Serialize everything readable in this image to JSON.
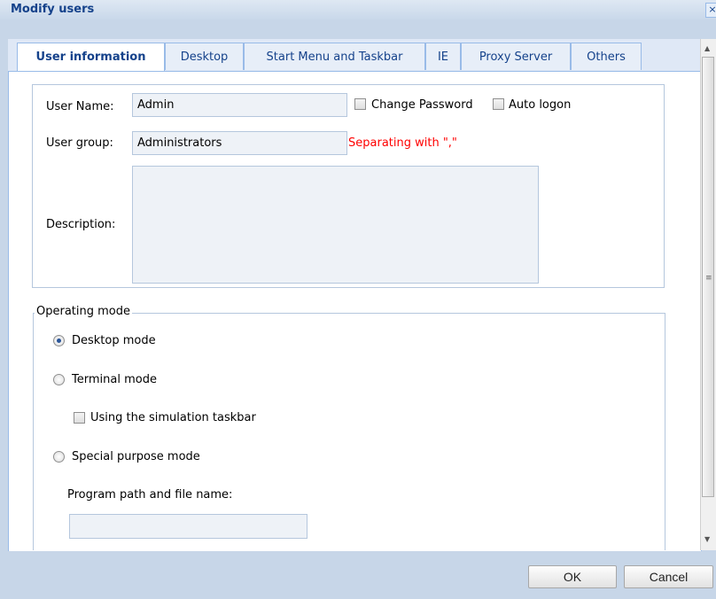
{
  "window": {
    "title": "Modify users",
    "close_glyph": "×"
  },
  "tabs": [
    {
      "label": "User information",
      "active": true
    },
    {
      "label": "Desktop"
    },
    {
      "label": "Start Menu and Taskbar"
    },
    {
      "label": "IE"
    },
    {
      "label": "Proxy Server"
    },
    {
      "label": "Others"
    }
  ],
  "user_info": {
    "username_label": "User Name:",
    "username_value": "Admin",
    "change_password_label": "Change Password",
    "auto_logon_label": "Auto logon",
    "group_label": "User group:",
    "group_value": "Administrators",
    "group_hint": "Separating with \",\"",
    "description_label": "Description:",
    "description_value": ""
  },
  "operating_mode": {
    "legend": "Operating mode",
    "desktop_mode_label": "Desktop mode",
    "terminal_mode_label": "Terminal mode",
    "simulation_taskbar_label": "Using the simulation taskbar",
    "special_purpose_label": "Special purpose mode",
    "program_path_label": "Program path and file name:",
    "program_path_value": "",
    "selected": "Desktop mode"
  },
  "buttons": {
    "ok": "OK",
    "cancel": "Cancel"
  },
  "colors": {
    "title": "#15428b",
    "hint": "#ff0000",
    "frame": "#c7d6e8",
    "tab_border": "#99bbe8"
  }
}
